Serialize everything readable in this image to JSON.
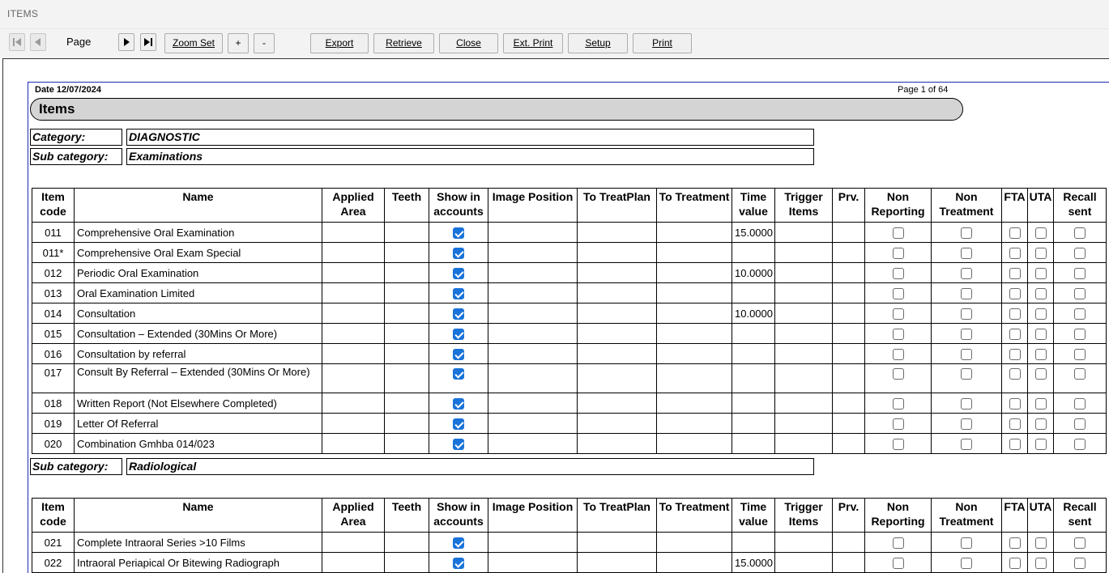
{
  "window": {
    "title": "ITEMS"
  },
  "toolbar": {
    "page_label": "Page",
    "zoom_set": "Zoom Set",
    "zoom_in": "+",
    "zoom_out": "-",
    "export": "Export",
    "retrieve": "Retrieve",
    "close": "Close",
    "ext_print": "Ext. Print",
    "setup": "Setup",
    "print": "Print"
  },
  "report": {
    "date": "Date 12/07/2024",
    "page_info": "Page 1 of 64",
    "title": "Items",
    "category_label": "Category:",
    "category_value": "DIAGNOSTIC",
    "subcategory_label": "Sub category:",
    "columns": {
      "item_code": "Item code",
      "name": "Name",
      "applied_area": "Applied Area",
      "teeth": "Teeth",
      "show_in_accounts": "Show in accounts",
      "image_position": "Image Position",
      "to_treatplan": "To TreatPlan",
      "to_treatment": "To Treatment",
      "time_value": "Time value",
      "trigger_items": "Trigger Items",
      "prv": "Prv.",
      "non_reporting": "Non Reporting",
      "non_treatment": "Non Treatment",
      "fta": "FTA",
      "uta": "UTA",
      "recall_sent": "Recall sent"
    },
    "sections": [
      {
        "subcategory": "Examinations",
        "rows": [
          {
            "code": "011",
            "name": "Comprehensive Oral Examination",
            "show_in_accounts": true,
            "time": "15.0000"
          },
          {
            "code": "011*",
            "name": "Comprehensive Oral Exam Special",
            "show_in_accounts": true,
            "time": ""
          },
          {
            "code": "012",
            "name": "Periodic Oral Examination",
            "show_in_accounts": true,
            "time": "10.0000"
          },
          {
            "code": "013",
            "name": "Oral Examination Limited",
            "show_in_accounts": true,
            "time": ""
          },
          {
            "code": "014",
            "name": "Consultation",
            "show_in_accounts": true,
            "time": "10.0000"
          },
          {
            "code": "015",
            "name": "Consultation – Extended (30Mins Or More)",
            "show_in_accounts": true,
            "time": ""
          },
          {
            "code": "016",
            "name": "Consultation by referral",
            "show_in_accounts": true,
            "time": ""
          },
          {
            "code": "017",
            "name": "Consult By Referral – Extended  (30Mins Or More)",
            "show_in_accounts": true,
            "time": "",
            "tall": true
          },
          {
            "code": "018",
            "name": "Written Report (Not Elsewhere Completed)",
            "show_in_accounts": true,
            "time": ""
          },
          {
            "code": "019",
            "name": "Letter Of Referral",
            "show_in_accounts": true,
            "time": ""
          },
          {
            "code": "020",
            "name": "Combination Gmhba 014/023",
            "show_in_accounts": true,
            "time": ""
          }
        ]
      },
      {
        "subcategory": "Radiological",
        "rows": [
          {
            "code": "021",
            "name": "Complete Intraoral Series >10 Films",
            "show_in_accounts": true,
            "time": ""
          },
          {
            "code": "022",
            "name": "Intraoral Periapical Or Bitewing Radiograph",
            "show_in_accounts": true,
            "time": "15.0000"
          }
        ]
      }
    ]
  }
}
